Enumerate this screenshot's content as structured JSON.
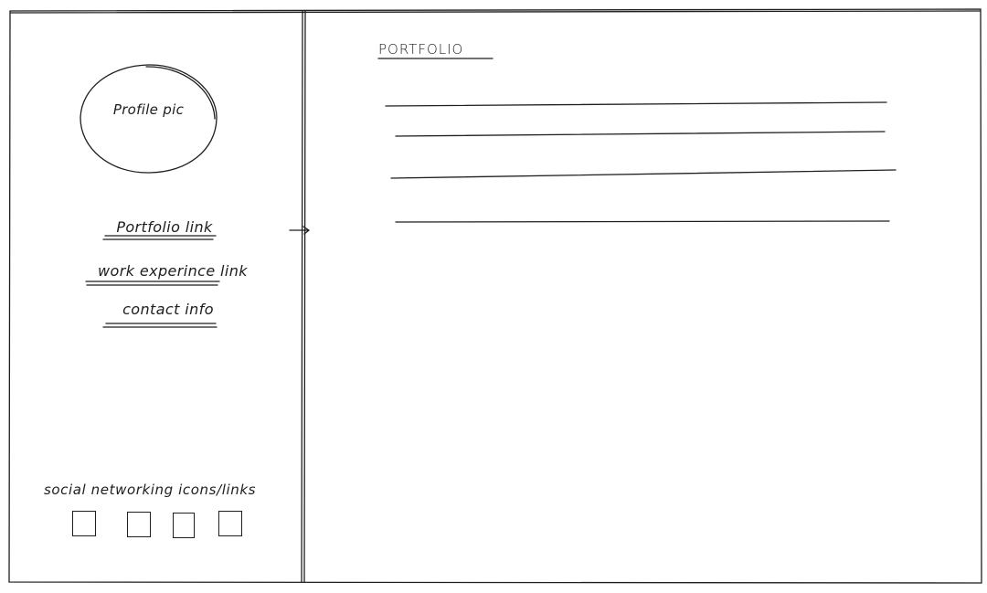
{
  "sidebar": {
    "profile_pic_label": "Profile pic",
    "nav": {
      "portfolio": "Portfolio link",
      "work": "work experince link",
      "contact": "contact info"
    },
    "social_label": "social networking icons/links",
    "social_icons": [
      "social-link-1",
      "social-link-2",
      "social-link-3",
      "social-link-4"
    ]
  },
  "main": {
    "title": "PORTFOLIO"
  },
  "colors": {
    "stroke": "#1e1e1e",
    "background": "#ffffff"
  }
}
